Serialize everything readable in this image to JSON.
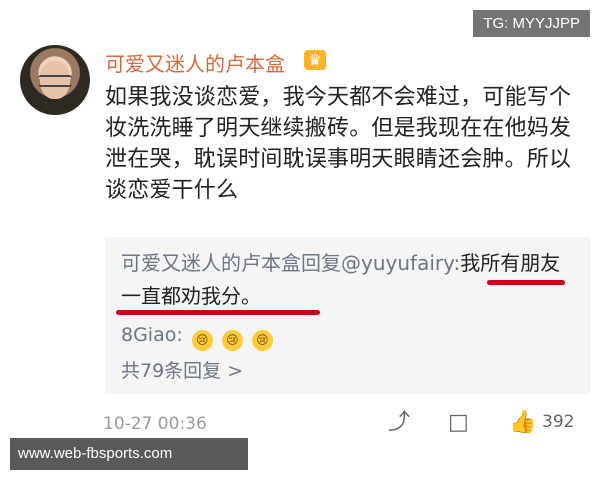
{
  "watermarks": {
    "top": "TG: MYYJJPP",
    "bottom": "www.web-fbsports.com"
  },
  "post": {
    "username": "可爱又迷人的卢本盒",
    "body": "如果我没谈恋爱，我今天都不会难过，可能写个妆洗洗睡了明天继续搬砖。但是我现在在他妈发泄在哭，耽误时间耽误事明天眼睛还会肿。所以谈恋爱干什么",
    "timestamp": "10-27 00:36",
    "like_count": "392"
  },
  "reply": {
    "prefix": "可爱又迷人的卢本盒回复@yuyufairy:",
    "text": "我所有朋友一直都劝我分。",
    "sub_user": "8Giao:",
    "sub_emojis": [
      "😢",
      "😢",
      "😢"
    ],
    "view_more": "共79条回复 >"
  },
  "icons": {
    "crown": "crown-icon",
    "share": "share-icon",
    "comment": "comment-icon",
    "like": "thumbs-up-icon"
  },
  "colors": {
    "username": "#d56a3d",
    "reply_username": "#6b7686",
    "highlight_line": "#c8001b"
  }
}
